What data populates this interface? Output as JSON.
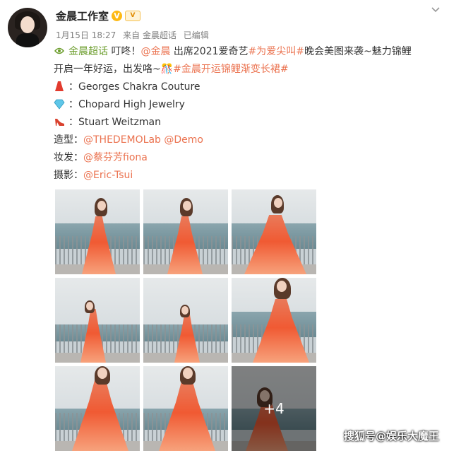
{
  "post": {
    "author": "金晨工作室",
    "verified_mark": "V",
    "level_badge": "V",
    "date": "1月15日 18:27",
    "source": "来自 金晨超话",
    "edited": "已编辑",
    "lines": {
      "l1_super": "金晨超话",
      "l1_text1": " 叮咚！",
      "l1_mention": "@金晨",
      "l1_text2": " 出席2021爱奇艺",
      "l1_tag": "#为爱尖叫#",
      "l1_text3": "晚会美图来袭~魅力锦鲤",
      "l2_text": "开启一年好运，出发咯~",
      "l2_emoji": "🎊",
      "l2_tag": "#金晨开运锦鲤渐变长裙#",
      "dress_label": "：Georges Chakra Couture",
      "jewel_label": "：Chopard High Jewelry",
      "shoe_label": "：Stuart Weitzman",
      "styling_label": "造型：",
      "styling_value": "@THEDEMOLab @Demo",
      "makeup_label": "妆发：",
      "makeup_value": "@蔡芬芳fiona",
      "photo_label": "摄影：",
      "photo_value": "@Eric-Tsui"
    },
    "more_photos": "+4"
  },
  "watermark": "搜狐号@娱乐大魔王",
  "icons": {
    "dress": "dress-icon",
    "jewel": "gem-icon",
    "shoe": "high-heel-icon",
    "chevron": "chevron-down-icon",
    "super_topic": "super-topic-icon"
  }
}
